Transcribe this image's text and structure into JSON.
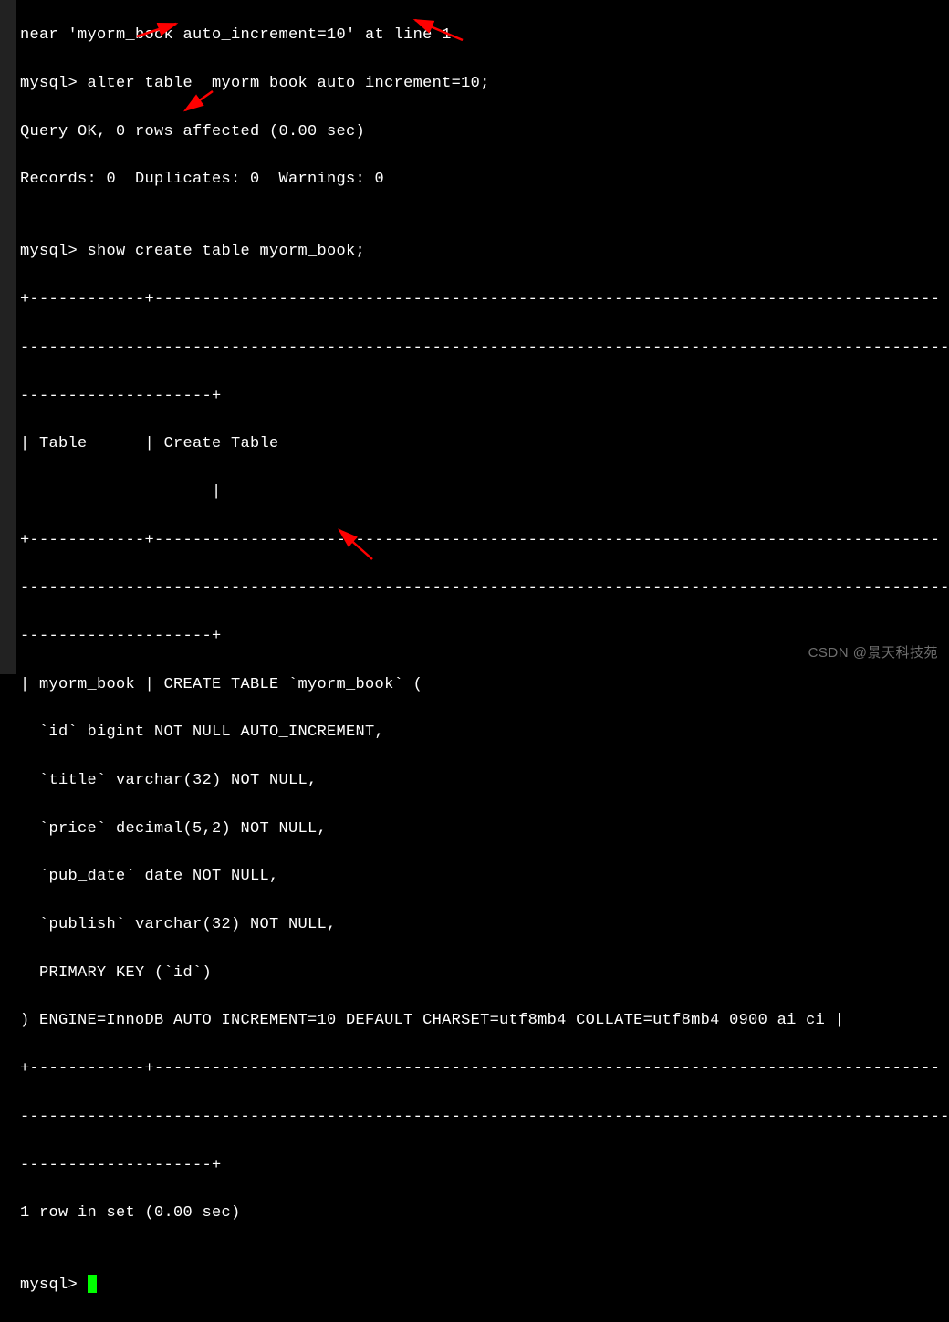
{
  "terminal": {
    "lines": {
      "l0": "near 'myorm_book auto_increment=10' at line 1",
      "l1": "mysql> alter table  myorm_book auto_increment=10;",
      "l2": "Query OK, 0 rows affected (0.00 sec)",
      "l3": "Records: 0  Duplicates: 0  Warnings: 0",
      "l4": "",
      "l5": "mysql> show create table myorm_book;",
      "l6": "+------------+----------------------------------------------------------------------------------",
      "l7": "----------------------------------------------------------------------------------------------------",
      "l8": "--------------------+",
      "l9": "| Table      | Create Table                                                                                                                                                                                                                                    ",
      "l10": "                    |",
      "l11": "+------------+----------------------------------------------------------------------------------",
      "l12": "----------------------------------------------------------------------------------------------------",
      "l13": "--------------------+",
      "l14": "| myorm_book | CREATE TABLE `myorm_book` (",
      "l15": "  `id` bigint NOT NULL AUTO_INCREMENT,",
      "l16": "  `title` varchar(32) NOT NULL,",
      "l17": "  `price` decimal(5,2) NOT NULL,",
      "l18": "  `pub_date` date NOT NULL,",
      "l19": "  `publish` varchar(32) NOT NULL,",
      "l20": "  PRIMARY KEY (`id`)",
      "l21": ") ENGINE=InnoDB AUTO_INCREMENT=10 DEFAULT CHARSET=utf8mb4 COLLATE=utf8mb4_0900_ai_ci |",
      "l22": "+------------+----------------------------------------------------------------------------------",
      "l23": "----------------------------------------------------------------------------------------------------",
      "l24": "--------------------+",
      "l25": "1 row in set (0.00 sec)",
      "l26": "",
      "l27": "mysql> "
    }
  },
  "watermark": "CSDN @景天科技苑",
  "annotations": {
    "arrow1": "red-arrow",
    "arrow2": "red-arrow",
    "arrow3": "red-arrow",
    "arrow4": "red-arrow"
  }
}
